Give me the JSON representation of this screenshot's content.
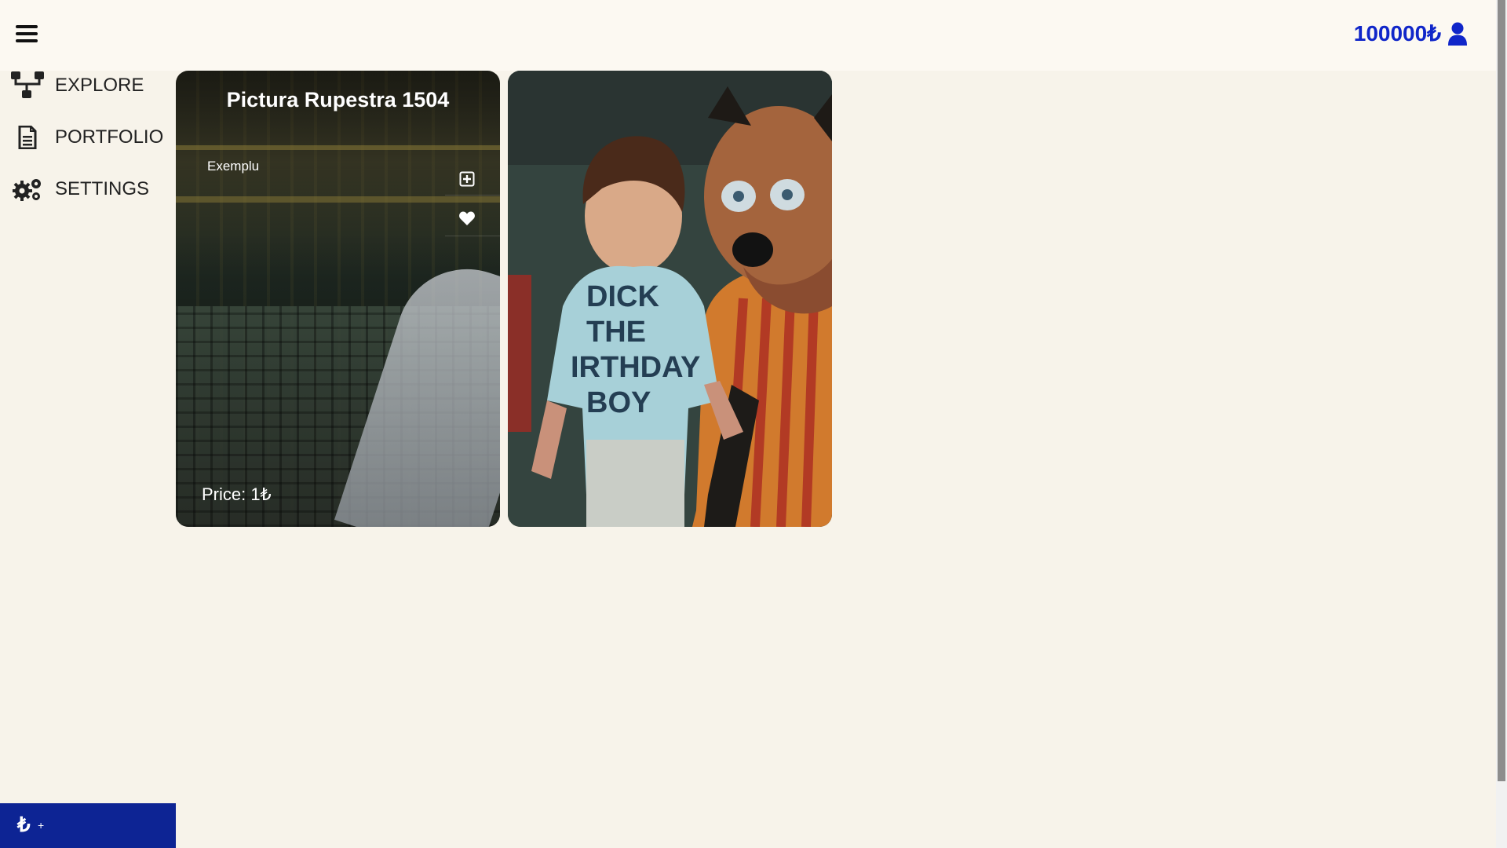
{
  "header": {
    "balance": "100000₺"
  },
  "sidebar": {
    "items": [
      {
        "label": "EXPLORE",
        "icon": "sitemap-icon"
      },
      {
        "label": "PORTFOLIO",
        "icon": "file-text-icon"
      },
      {
        "label": "SETTINGS",
        "icon": "gears-icon"
      }
    ]
  },
  "cards": [
    {
      "title": "Pictura Rupestra 1504",
      "subtitle": "Exemplu",
      "price": "Price: 1₺"
    },
    {
      "shirt_text": [
        "DICK",
        "THE",
        "IRTHDAY",
        "BOY"
      ]
    }
  ],
  "bottom": {
    "symbol": "₺",
    "plus": "+"
  },
  "colors": {
    "accent": "#1026c9",
    "bottom_bar": "#0d2494",
    "background": "#f7f3ea"
  }
}
